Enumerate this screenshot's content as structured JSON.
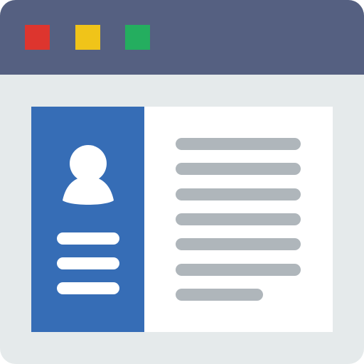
{
  "colors": {
    "window_background": "#e5eaeb",
    "titlebar": "#556081",
    "close_button": "#dd352e",
    "minimize_button": "#f0c419",
    "maximize_button": "#24ae5f",
    "sidebar": "#366db6",
    "content_panel": "#ffffff",
    "text_placeholder": "#afb6bb",
    "sidebar_placeholder": "#ffffff"
  },
  "icons": {
    "avatar": "user-silhouette-icon"
  },
  "content": {
    "placeholder_line_count": 7,
    "sidebar_line_count": 3
  }
}
